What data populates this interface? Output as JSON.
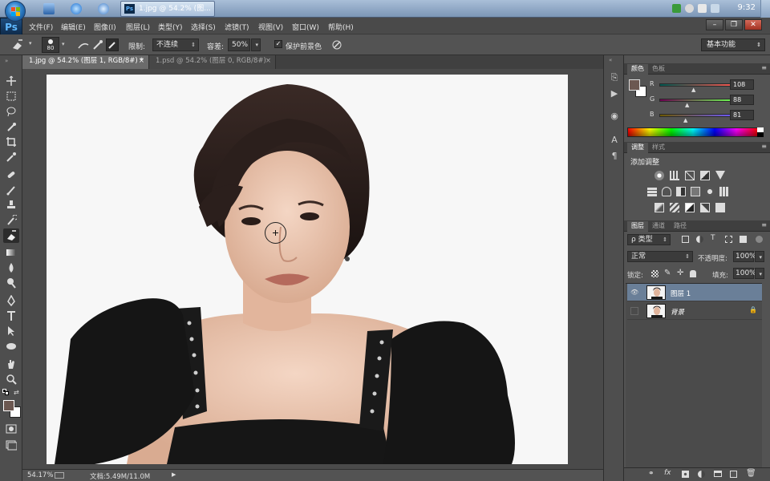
{
  "taskbar": {
    "active_window_label": "1.jpg @ 54.2% (图...",
    "clock": "9:32"
  },
  "app": {
    "logo": "Ps"
  },
  "menubar": {
    "items": [
      "文件(F)",
      "编辑(E)",
      "图像(I)",
      "图层(L)",
      "类型(Y)",
      "选择(S)",
      "滤镜(T)",
      "视图(V)",
      "窗口(W)",
      "帮助(H)"
    ]
  },
  "options": {
    "brush_size": "80",
    "limit_label": "限制:",
    "limit_value": "不连续",
    "tolerance_label": "容差:",
    "tolerance_value": "50%",
    "protect_foreground_label": "保护前景色",
    "protect_foreground_checked": true,
    "workspace": "基本功能"
  },
  "tabs": [
    {
      "label": "1.jpg @ 54.2% (图层 1, RGB/8#) *",
      "close": "×",
      "active": true
    },
    {
      "label": "1.psd @ 54.2% (图层 0, RGB/8#)",
      "close": "×",
      "active": false
    }
  ],
  "status": {
    "zoom": "54.17%",
    "doc_info": "文档:5.49M/11.0M",
    "nav_arrow": "▶"
  },
  "color_panel": {
    "tabs": [
      "颜色",
      "色板"
    ],
    "r_label": "R",
    "r_value": "108",
    "g_label": "G",
    "g_value": "88",
    "b_label": "B",
    "b_value": "81",
    "foreground": "#6c5851",
    "background": "#ffffff"
  },
  "adjustments_panel": {
    "tabs": [
      "调整",
      "样式"
    ],
    "heading": "添加调整"
  },
  "layers_panel": {
    "tabs": [
      "图层",
      "通道",
      "路径"
    ],
    "filter_kind": "ρ 类型",
    "blend_mode": "正常",
    "opacity_label": "不透明度:",
    "opacity_value": "100%",
    "lock_label": "锁定:",
    "fill_label": "填充:",
    "fill_value": "100%",
    "layers": [
      {
        "name": "图层 1",
        "visible": true,
        "selected": true,
        "locked": false
      },
      {
        "name": "背景",
        "visible": false,
        "selected": false,
        "locked": true
      }
    ]
  },
  "colors": {
    "ui_dark": "#535353",
    "selection": "#6a7f98",
    "taskbar": "#8ea6c4"
  }
}
